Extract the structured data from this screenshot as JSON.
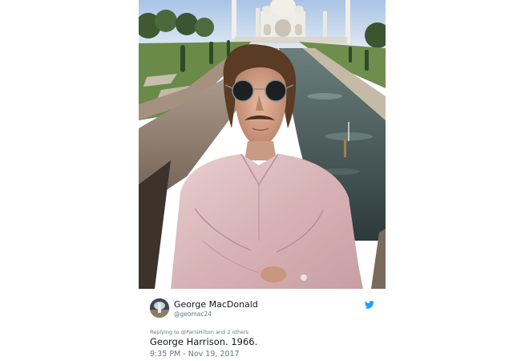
{
  "tweet": {
    "display_name": "George MacDonald",
    "handle": "@geomac24",
    "replying_prefix": "Replying to",
    "replying_user": "@ParisHilton",
    "replying_and": "and",
    "replying_others": "2 others",
    "text": "George Harrison. 1966.",
    "timestamp": "9:35 PM - Nov 19, 2017"
  },
  "icons": {
    "network": "twitter-bird-icon",
    "twitter_blue": "#1da1f2"
  },
  "colors": {
    "text_primary": "#14171a",
    "text_secondary": "#657786"
  }
}
